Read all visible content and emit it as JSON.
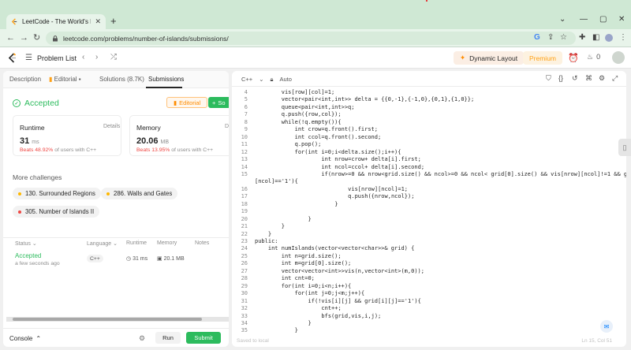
{
  "browser": {
    "tab_title": "LeetCode - The World's Leading",
    "new_tab": "+",
    "url": "leetcode.com/problems/number-of-islands/submissions/",
    "window_controls": [
      "⌄",
      "—",
      "▢",
      "✕"
    ]
  },
  "nav": {
    "problem_list": "Problem List",
    "dynamic_layout": "Dynamic Layout",
    "premium": "Premium",
    "streak_count": "0"
  },
  "left_tabs": [
    {
      "label": "Description"
    },
    {
      "label": "Editorial"
    },
    {
      "label": "Solutions (8.7K)"
    },
    {
      "label": "Submissions"
    }
  ],
  "result": {
    "status": "Accepted",
    "editorial_btn": "Editorial",
    "solution_btn": "So"
  },
  "runtime": {
    "label": "Runtime",
    "details": "Details",
    "value": "31",
    "unit": "ms",
    "beats_pct": "Beats 48.92%",
    "beats_rest": "of users with C++"
  },
  "memory": {
    "label": "Memory",
    "details": "D",
    "value": "20.06",
    "unit": "MB",
    "beats_pct": "Beats 13.95%",
    "beats_rest": "of users with C++"
  },
  "more_challenges": {
    "heading": "More challenges",
    "items": [
      {
        "label": "130. Surrounded Regions",
        "color": "#ffb800"
      },
      {
        "label": "286. Walls and Gates",
        "color": "#ffb800"
      },
      {
        "label": "305. Number of Islands II",
        "color": "#ef4743"
      }
    ]
  },
  "submissions": {
    "headers": [
      "Status",
      "Language",
      "Runtime",
      "Memory",
      "Notes"
    ],
    "rows": [
      {
        "status": "Accepted",
        "when": "a few seconds ago",
        "language": "C++",
        "runtime": "31 ms",
        "memory": "20.1 MB"
      }
    ]
  },
  "footer": {
    "console": "Console",
    "run": "Run",
    "submit": "Submit"
  },
  "editor": {
    "language": "C++",
    "mode": "Auto",
    "saved": "Saved to local",
    "position": "Ln 15, Col 51",
    "lines": [
      {
        "n": "4",
        "indent": 8,
        "text": "vis[row][col]=1;"
      },
      {
        "n": "5",
        "indent": 8,
        "text": "vector<pair<int,int>> delta = {{0,-1},{-1,0},{0,1},{1,0}};"
      },
      {
        "n": "6",
        "indent": 8,
        "text": "queue<pair<int,int>>q;"
      },
      {
        "n": "7",
        "indent": 8,
        "text": "q.push({row,col});"
      },
      {
        "n": "8",
        "indent": 8,
        "text": "while(!q.empty()){"
      },
      {
        "n": "9",
        "indent": 12,
        "text": "int crow=q.front().first;"
      },
      {
        "n": "10",
        "indent": 12,
        "text": "int ccol=q.front().second;"
      },
      {
        "n": "11",
        "indent": 12,
        "text": "q.pop();"
      },
      {
        "n": "12",
        "indent": 12,
        "text": "for(int i=0;i<delta.size();i++){"
      },
      {
        "n": "13",
        "indent": 20,
        "text": "int nrow=crow+ delta[i].first;"
      },
      {
        "n": "14",
        "indent": 20,
        "text": "int ncol=ccol+ delta[i].second;"
      },
      {
        "n": "15",
        "indent": 20,
        "text": "if(nrow>=0 && nrow<grid.size() && ncol>=0 && ncol< grid[0].size() && vis[nrow][ncol]!=1 && grid[nrow]"
      },
      {
        "n": "",
        "indent": 0,
        "text": "[ncol]=='1'){"
      },
      {
        "n": "16",
        "indent": 28,
        "text": "vis[nrow][ncol]=1;"
      },
      {
        "n": "17",
        "indent": 28,
        "text": "q.push({nrow,ncol});"
      },
      {
        "n": "18",
        "indent": 24,
        "text": "}"
      },
      {
        "n": "19",
        "indent": 16,
        "text": ""
      },
      {
        "n": "20",
        "indent": 16,
        "text": "}"
      },
      {
        "n": "21",
        "indent": 8,
        "text": "}"
      },
      {
        "n": "22",
        "indent": 4,
        "text": "}"
      },
      {
        "n": "23",
        "indent": 0,
        "text": "public:"
      },
      {
        "n": "24",
        "indent": 4,
        "text": "int numIslands(vector<vector<char>>& grid) {"
      },
      {
        "n": "25",
        "indent": 8,
        "text": "int n=grid.size();"
      },
      {
        "n": "26",
        "indent": 8,
        "text": "int m=grid[0].size();"
      },
      {
        "n": "27",
        "indent": 8,
        "text": "vector<vector<int>>vis(n,vector<int>(m,0));"
      },
      {
        "n": "28",
        "indent": 8,
        "text": "int cnt=0;"
      },
      {
        "n": "29",
        "indent": 8,
        "text": "for(int i=0;i<n;i++){"
      },
      {
        "n": "30",
        "indent": 12,
        "text": "for(int j=0;j<m;j++){"
      },
      {
        "n": "31",
        "indent": 16,
        "text": "if(!vis[i][j] && grid[i][j]=='1'){"
      },
      {
        "n": "32",
        "indent": 20,
        "text": "cnt++;"
      },
      {
        "n": "33",
        "indent": 20,
        "text": "bfs(grid,vis,i,j);"
      },
      {
        "n": "34",
        "indent": 16,
        "text": "}"
      },
      {
        "n": "35",
        "indent": 12,
        "text": "}"
      }
    ]
  }
}
